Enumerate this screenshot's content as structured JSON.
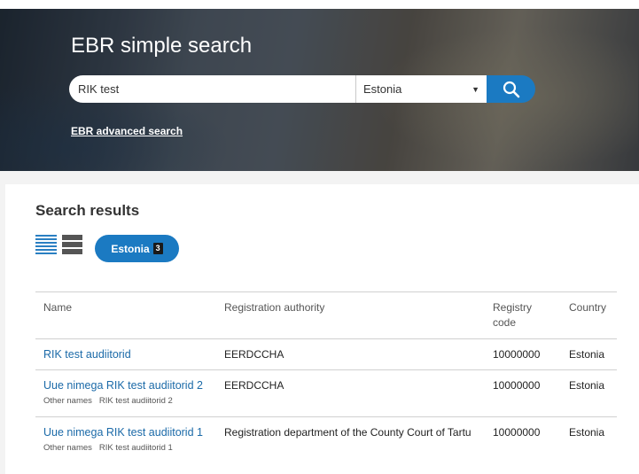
{
  "hero": {
    "title": "EBR simple search",
    "search": {
      "value": "RIK test",
      "placeholder": ""
    },
    "country_select": {
      "selected": "Estonia"
    },
    "advanced_link": "EBR advanced search"
  },
  "results": {
    "title": "Search results",
    "chip": {
      "label": "Estonia",
      "count": "3"
    },
    "columns": {
      "name": "Name",
      "authority": "Registration authority",
      "code": "Registry code",
      "country": "Country"
    },
    "rows": [
      {
        "name": "RIK test audiitorid",
        "other_label": "",
        "other_value": "",
        "authority": "EERDCCHA",
        "code": "10000000",
        "country": "Estonia"
      },
      {
        "name": "Uue nimega RIK test audiitorid 2",
        "other_label": "Other names",
        "other_value": "RIK test audiitorid 2",
        "authority": "EERDCCHA",
        "code": "10000000",
        "country": "Estonia"
      },
      {
        "name": "Uue nimega RIK test audiitorid 1",
        "other_label": "Other names",
        "other_value": "RIK test audiitorid 1",
        "authority": "Registration department of the County Court of Tartu",
        "code": "10000000",
        "country": "Estonia"
      }
    ]
  },
  "icons": {
    "search": "magnifier-icon",
    "caret": "caret-down-icon",
    "list_view": "list-view-icon",
    "compact_view": "compact-view-icon"
  },
  "colors": {
    "accent": "#1b7ac2",
    "link": "#1b6aa8"
  }
}
